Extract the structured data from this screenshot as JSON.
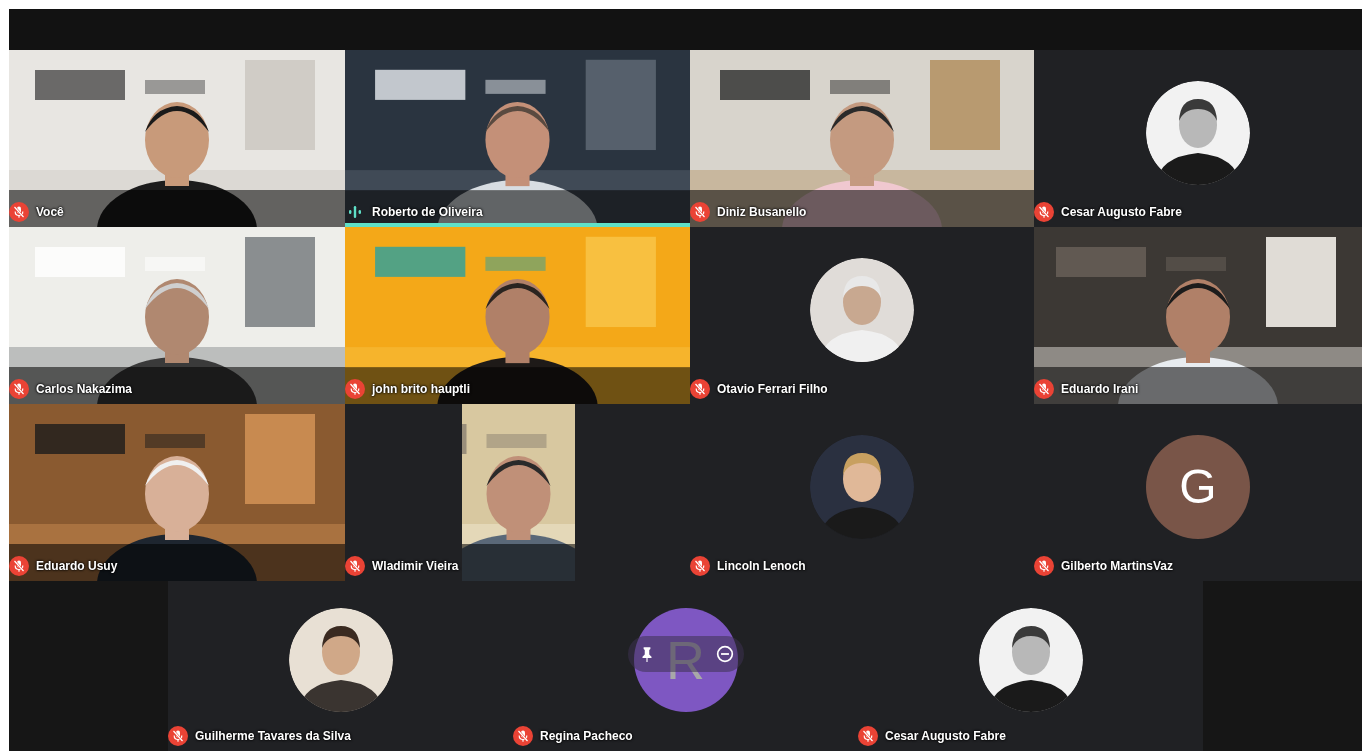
{
  "meeting": {
    "rows": [
      {
        "tiles": [
          {
            "name": "Você",
            "kind": "video",
            "muted": true,
            "speaking": false,
            "hovered": false
          },
          {
            "name": "Roberto de Oliveira",
            "kind": "video",
            "muted": false,
            "speaking": true,
            "hovered": false
          },
          {
            "name": "Diniz Busanello",
            "kind": "video",
            "muted": true,
            "speaking": false,
            "hovered": false
          },
          {
            "name": "Cesar Augusto Fabre",
            "kind": "avatar",
            "muted": true,
            "speaking": false,
            "hovered": false
          }
        ]
      },
      {
        "tiles": [
          {
            "name": "Carlos Nakazima",
            "kind": "video",
            "muted": true,
            "speaking": false,
            "hovered": false
          },
          {
            "name": "john brito hauptli",
            "kind": "video",
            "muted": true,
            "speaking": false,
            "hovered": false
          },
          {
            "name": "Otavio Ferrari Filho",
            "kind": "avatar",
            "muted": true,
            "speaking": false,
            "hovered": false
          },
          {
            "name": "Eduardo Irani",
            "kind": "video",
            "muted": true,
            "speaking": false,
            "hovered": false
          }
        ]
      },
      {
        "tiles": [
          {
            "name": "Eduardo Usuy",
            "kind": "video",
            "muted": true,
            "speaking": false,
            "hovered": false
          },
          {
            "name": "Wladimir Vieira",
            "kind": "video_narrow",
            "muted": true,
            "speaking": false,
            "hovered": false
          },
          {
            "name": "Lincoln Lenoch",
            "kind": "avatar",
            "muted": true,
            "speaking": false,
            "hovered": false
          },
          {
            "name": "Gilberto MartinsVaz",
            "kind": "initial",
            "initial": "G",
            "color": "#795548",
            "muted": true,
            "speaking": false,
            "hovered": false
          }
        ]
      },
      {
        "tiles": [
          {
            "name": "Guilherme Tavares da Silva",
            "kind": "avatar",
            "muted": true,
            "speaking": false,
            "hovered": false
          },
          {
            "name": "Regina Pacheco",
            "kind": "initial",
            "initial": "R",
            "color": "#7e57c2",
            "muted": true,
            "speaking": false,
            "hovered": true
          },
          {
            "name": "Cesar Augusto Fabre",
            "kind": "avatar",
            "muted": true,
            "speaking": false,
            "hovered": false
          }
        ]
      }
    ]
  }
}
